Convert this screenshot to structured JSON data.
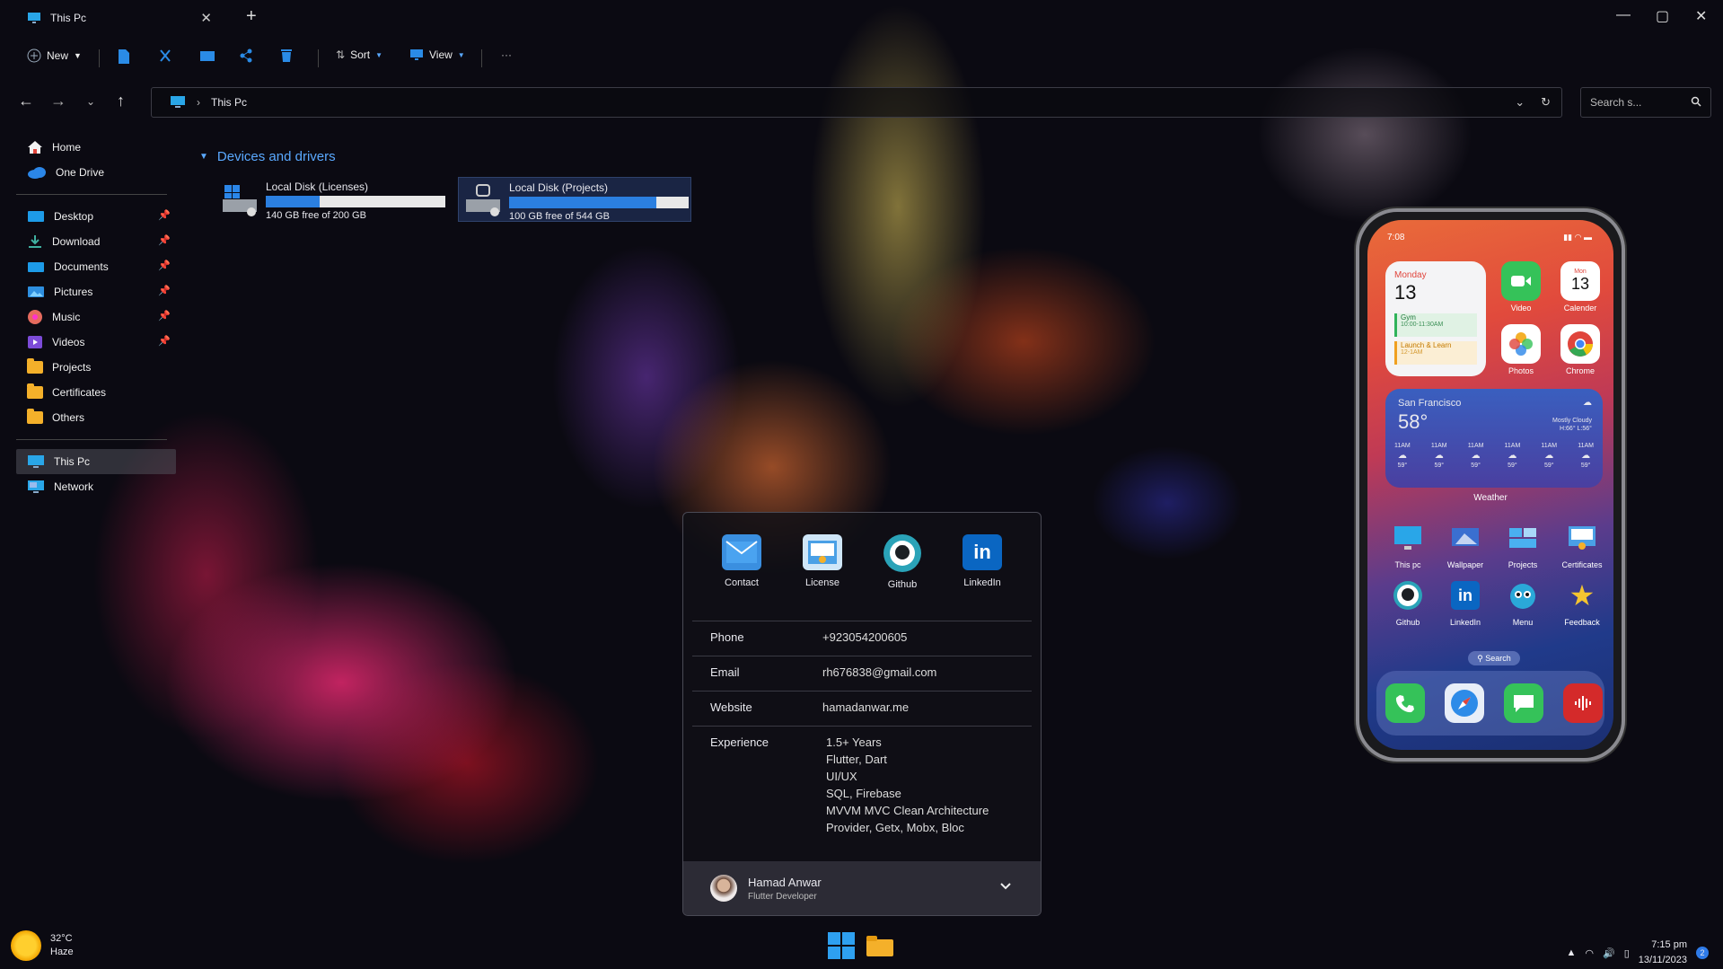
{
  "window": {
    "tab_title": "This Pc"
  },
  "toolbar": {
    "new_label": "New",
    "sort_label": "Sort",
    "view_label": "View"
  },
  "address": {
    "path": "This Pc"
  },
  "search": {
    "placeholder": "Search s..."
  },
  "sidebar": {
    "top": [
      {
        "label": "Home",
        "icon": "home-icon"
      },
      {
        "label": "One Drive",
        "icon": "cloud-icon"
      }
    ],
    "pinned": [
      {
        "label": "Desktop",
        "icon": "desktop-icon",
        "pinned": true
      },
      {
        "label": "Download",
        "icon": "download-icon",
        "pinned": true
      },
      {
        "label": "Documents",
        "icon": "documents-icon",
        "pinned": true
      },
      {
        "label": "Pictures",
        "icon": "pictures-icon",
        "pinned": true
      },
      {
        "label": "Music",
        "icon": "music-icon",
        "pinned": true
      },
      {
        "label": "Videos",
        "icon": "videos-icon",
        "pinned": true
      },
      {
        "label": "Projects",
        "icon": "folder-icon",
        "pinned": false
      },
      {
        "label": "Certificates",
        "icon": "folder-icon",
        "pinned": false
      },
      {
        "label": "Others",
        "icon": "folder-icon",
        "pinned": false
      }
    ],
    "bottom": [
      {
        "label": "This Pc",
        "icon": "pc-icon",
        "active": true
      },
      {
        "label": "Network",
        "icon": "network-icon",
        "active": false
      }
    ]
  },
  "devices": {
    "heading": "Devices and drivers",
    "drives": [
      {
        "name": "Local Disk (Licenses)",
        "free_text": "140 GB free of 200 GB",
        "used_fraction": 0.3
      },
      {
        "name": "Local Disk (Projects)",
        "free_text": "100 GB free of 544 GB",
        "used_fraction": 0.82
      }
    ]
  },
  "card": {
    "links": [
      {
        "label": "Contact",
        "icon": "mail-icon",
        "color": "#3a8fe0"
      },
      {
        "label": "License",
        "icon": "license-icon",
        "color": "#4aa0e6"
      },
      {
        "label": "Github",
        "icon": "github-icon",
        "color": "#2aa3b8"
      },
      {
        "label": "LinkedIn",
        "icon": "linkedin-icon",
        "color": "#0a66c2"
      }
    ],
    "phone_label": "Phone",
    "phone": "+923054200605",
    "email_label": "Email",
    "email": "rh676838@gmail.com",
    "website_label": "Website",
    "website": "hamadanwar.me",
    "experience_label": "Experience",
    "experience": [
      "1.5+ Years",
      "Flutter, Dart",
      "UI/UX",
      "SQL, Firebase",
      "MVVM MVC Clean Architecture",
      "Provider, Getx, Mobx, Bloc"
    ],
    "profile_name": "Hamad Anwar",
    "profile_role": "Flutter Developer"
  },
  "phone": {
    "time": "7:08",
    "cal_day": "Monday",
    "cal_date": "13",
    "event1_title": "Gym",
    "event1_time": "10:00-11:30AM",
    "event2_title": "Launch & Learn",
    "event2_time": "12-1AM",
    "cal_app_day": "Mon",
    "cal_app_date": "13",
    "weather_city": "San Francisco",
    "weather_temp": "58°",
    "weather_desc": "Mostly Cloudy",
    "weather_hl": "H:66° L:56°",
    "hourly": [
      {
        "time": "11AM",
        "temp": "59°"
      },
      {
        "time": "11AM",
        "temp": "59°"
      },
      {
        "time": "11AM",
        "temp": "59°"
      },
      {
        "time": "11AM",
        "temp": "59°"
      },
      {
        "time": "11AM",
        "temp": "59°"
      },
      {
        "time": "11AM",
        "temp": "59°"
      }
    ],
    "weather_widget_label": "Weather",
    "apps_top": [
      {
        "label": "Video",
        "icon": "facetime-icon"
      },
      {
        "label": "Calender",
        "icon": "calendar-icon"
      },
      {
        "label": "Photos",
        "icon": "photos-icon"
      },
      {
        "label": "Chrome",
        "icon": "chrome-icon"
      }
    ],
    "apps_grid": [
      {
        "label": "This pc",
        "icon": "pc-icon"
      },
      {
        "label": "Wallpaper",
        "icon": "wallpaper-icon"
      },
      {
        "label": "Projects",
        "icon": "projects-icon"
      },
      {
        "label": "Certificates",
        "icon": "certificates-icon"
      },
      {
        "label": "Github",
        "icon": "github-icon"
      },
      {
        "label": "LinkedIn",
        "icon": "linkedin-icon"
      },
      {
        "label": "Menu",
        "icon": "menu-icon"
      },
      {
        "label": "Feedback",
        "icon": "star-icon"
      }
    ],
    "search_label": "Search"
  },
  "taskbar": {
    "temp": "32°C",
    "condition": "Haze",
    "time": "7:15 pm",
    "date": "13/11/2023",
    "notifications": "2"
  }
}
